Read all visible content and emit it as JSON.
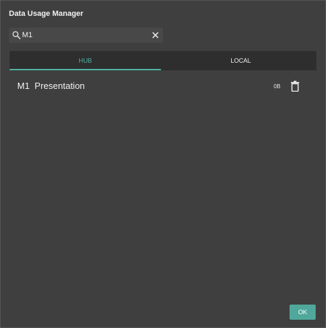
{
  "dialog": {
    "title": "Data Usage Manager"
  },
  "search": {
    "value": "M1",
    "icon": "search-icon",
    "clear_icon": "close-icon"
  },
  "tabs": [
    {
      "label": "HUB",
      "active": true
    },
    {
      "label": "LOCAL",
      "active": false
    }
  ],
  "items": [
    {
      "name": "M1  Presentation",
      "size": "0B",
      "delete_icon": "trash-icon"
    }
  ],
  "footer": {
    "ok_label": "OK"
  },
  "colors": {
    "accent": "#4fb3a3",
    "button": "#4fa89b",
    "background": "#3f3f3f",
    "tabbar": "#2e2e2e"
  }
}
